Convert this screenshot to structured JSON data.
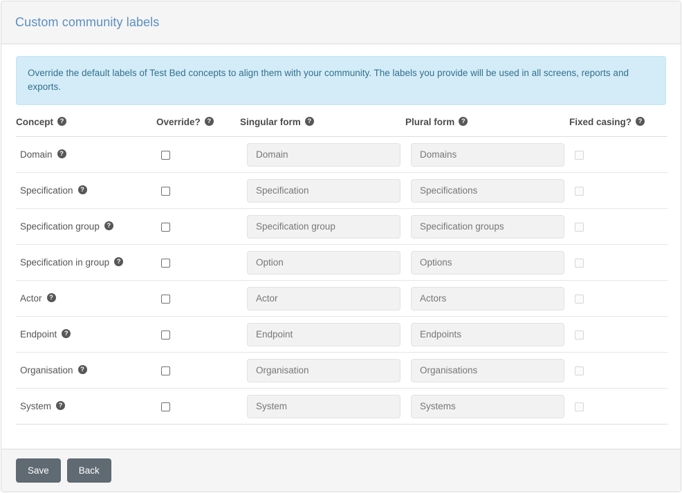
{
  "page": {
    "title": "Custom community labels",
    "alert": "Override the default labels of Test Bed concepts to align them with your community. The labels you provide will be used in all screens, reports and exports."
  },
  "table": {
    "headers": {
      "concept": "Concept",
      "override": "Override?",
      "singular": "Singular form",
      "plural": "Plural form",
      "fixed": "Fixed casing?"
    },
    "help_icon": "?",
    "rows": [
      {
        "concept": "Domain",
        "singular": "Domain",
        "plural": "Domains",
        "override": false,
        "fixed": false
      },
      {
        "concept": "Specification",
        "singular": "Specification",
        "plural": "Specifications",
        "override": false,
        "fixed": false
      },
      {
        "concept": "Specification group",
        "singular": "Specification group",
        "plural": "Specification groups",
        "override": false,
        "fixed": false
      },
      {
        "concept": "Specification in group",
        "singular": "Option",
        "plural": "Options",
        "override": false,
        "fixed": false
      },
      {
        "concept": "Actor",
        "singular": "Actor",
        "plural": "Actors",
        "override": false,
        "fixed": false
      },
      {
        "concept": "Endpoint",
        "singular": "Endpoint",
        "plural": "Endpoints",
        "override": false,
        "fixed": false
      },
      {
        "concept": "Organisation",
        "singular": "Organisation",
        "plural": "Organisations",
        "override": false,
        "fixed": false
      },
      {
        "concept": "System",
        "singular": "System",
        "plural": "Systems",
        "override": false,
        "fixed": false
      }
    ]
  },
  "footer": {
    "save_label": "Save",
    "back_label": "Back"
  },
  "colors": {
    "title": "#5b8ec4",
    "alert_bg": "#d4ecf7",
    "alert_text": "#31708f",
    "button": "#5f6a72",
    "help_icon": "#575757"
  }
}
